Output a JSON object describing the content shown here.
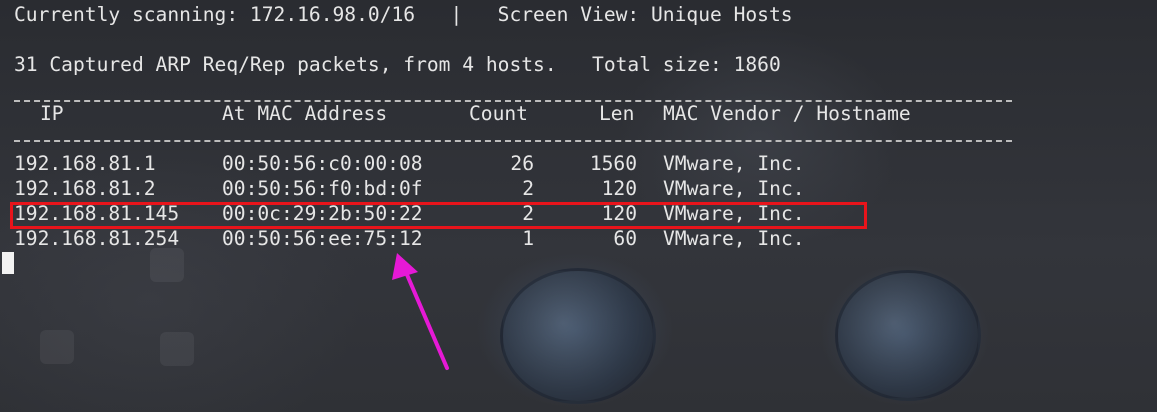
{
  "status": {
    "scanning_line": "Currently scanning: 172.16.98.0/16   |   Screen View: Unique Hosts",
    "summary_line": "31 Captured ARP Req/Rep packets, from 4 hosts.   Total size: 1860"
  },
  "table": {
    "headers": {
      "ip": "IP",
      "mac": "At MAC Address",
      "count": "Count",
      "len": "Len",
      "vendor": "MAC Vendor / Hostname"
    },
    "rows": [
      {
        "ip": "192.168.81.1",
        "mac": "00:50:56:c0:00:08",
        "count": "26",
        "len": "1560",
        "vendor": "VMware, Inc."
      },
      {
        "ip": "192.168.81.2",
        "mac": "00:50:56:f0:bd:0f",
        "count": "2",
        "len": "120",
        "vendor": "VMware, Inc."
      },
      {
        "ip": "192.168.81.145",
        "mac": "00:0c:29:2b:50:22",
        "count": "2",
        "len": "120",
        "vendor": "VMware, Inc."
      },
      {
        "ip": "192.168.81.254",
        "mac": "00:50:56:ee:75:12",
        "count": "1",
        "len": "60",
        "vendor": "VMware, Inc."
      }
    ],
    "highlighted_row": 2
  },
  "annotations": {
    "highlight_color": "#e8141b",
    "arrow_color": "#e619d6"
  },
  "colors": {
    "text": "#e6e6e6",
    "background": "#2b2d33"
  }
}
